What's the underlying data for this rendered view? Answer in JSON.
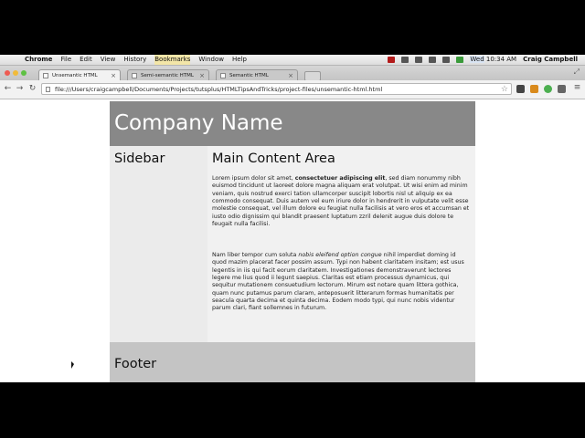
{
  "menubar": {
    "app_name": "Chrome",
    "menus": [
      "File",
      "Edit",
      "View",
      "History",
      "Bookmarks",
      "Window",
      "Help"
    ],
    "clock": "10:34 AM",
    "day": "Wed",
    "user": "Craig Campbell"
  },
  "tabs": [
    {
      "label": "Unsemantic HTML",
      "active": true
    },
    {
      "label": "Semi-semantic HTML",
      "active": false
    },
    {
      "label": "Semantic HTML",
      "active": false
    }
  ],
  "toolbar": {
    "url": "file:///Users/craigcampbell/Documents/Projects/tutsplus/HTMLTipsAndTricks/project-files/unsemantic-html.html"
  },
  "page": {
    "company_name": "Company Name",
    "sidebar_title": "Sidebar",
    "main_title": "Main Content Area",
    "p1_before": "Lorem ipsum dolor sit amet, ",
    "p1_bold": "consectetuer adipiscing elit",
    "p1_after": ", sed diam nonummy nibh euismod tincidunt ut laoreet dolore magna aliquam erat volutpat. Ut wisi enim ad minim veniam, quis nostrud exerci tation ullamcorper suscipit lobortis nisl ut aliquip ex ea commodo consequat. Duis autem vel eum iriure dolor in hendrerit in vulputate velit esse molestie consequat, vel illum dolore eu feugiat nulla facilisis at vero eros et accumsan et iusto odio dignissim qui blandit praesent luptatum zzril delenit augue duis dolore te feugait nulla facilisi.",
    "p2_before": "Nam liber tempor cum soluta ",
    "p2_italic": "nobis eleifend option congue",
    "p2_after": " nihil imperdiet doming id quod mazim placerat facer possim assum. Typi non habent claritatem insitam; est usus legentis in iis qui facit eorum claritatem. Investigationes demonstraverunt lectores legere me lius quod ii legunt saepius. Claritas est etiam processus dynamicus, qui sequitur mutationem consuetudium lectorum. Mirum est notare quam littera gothica, quam nunc putamus parum claram, anteposuerit litterarum formas humanitatis per seacula quarta decima et quinta decima. Eodem modo typi, qui nunc nobis videntur parum clari, fiant sollemnes in futurum.",
    "footer_title": "Footer"
  },
  "icons": {
    "apple": "apple-icon",
    "back": "back-arrow-icon",
    "forward": "forward-arrow-icon",
    "reload": "reload-icon",
    "bookmark_star": "star-icon",
    "chrome_menu": "hamburger-icon"
  },
  "colors": {
    "header_bg": "#888888",
    "sidebar_bg": "#ebebeb",
    "content_bg": "#f1f1f1",
    "footer_bg": "#c4c4c4"
  }
}
